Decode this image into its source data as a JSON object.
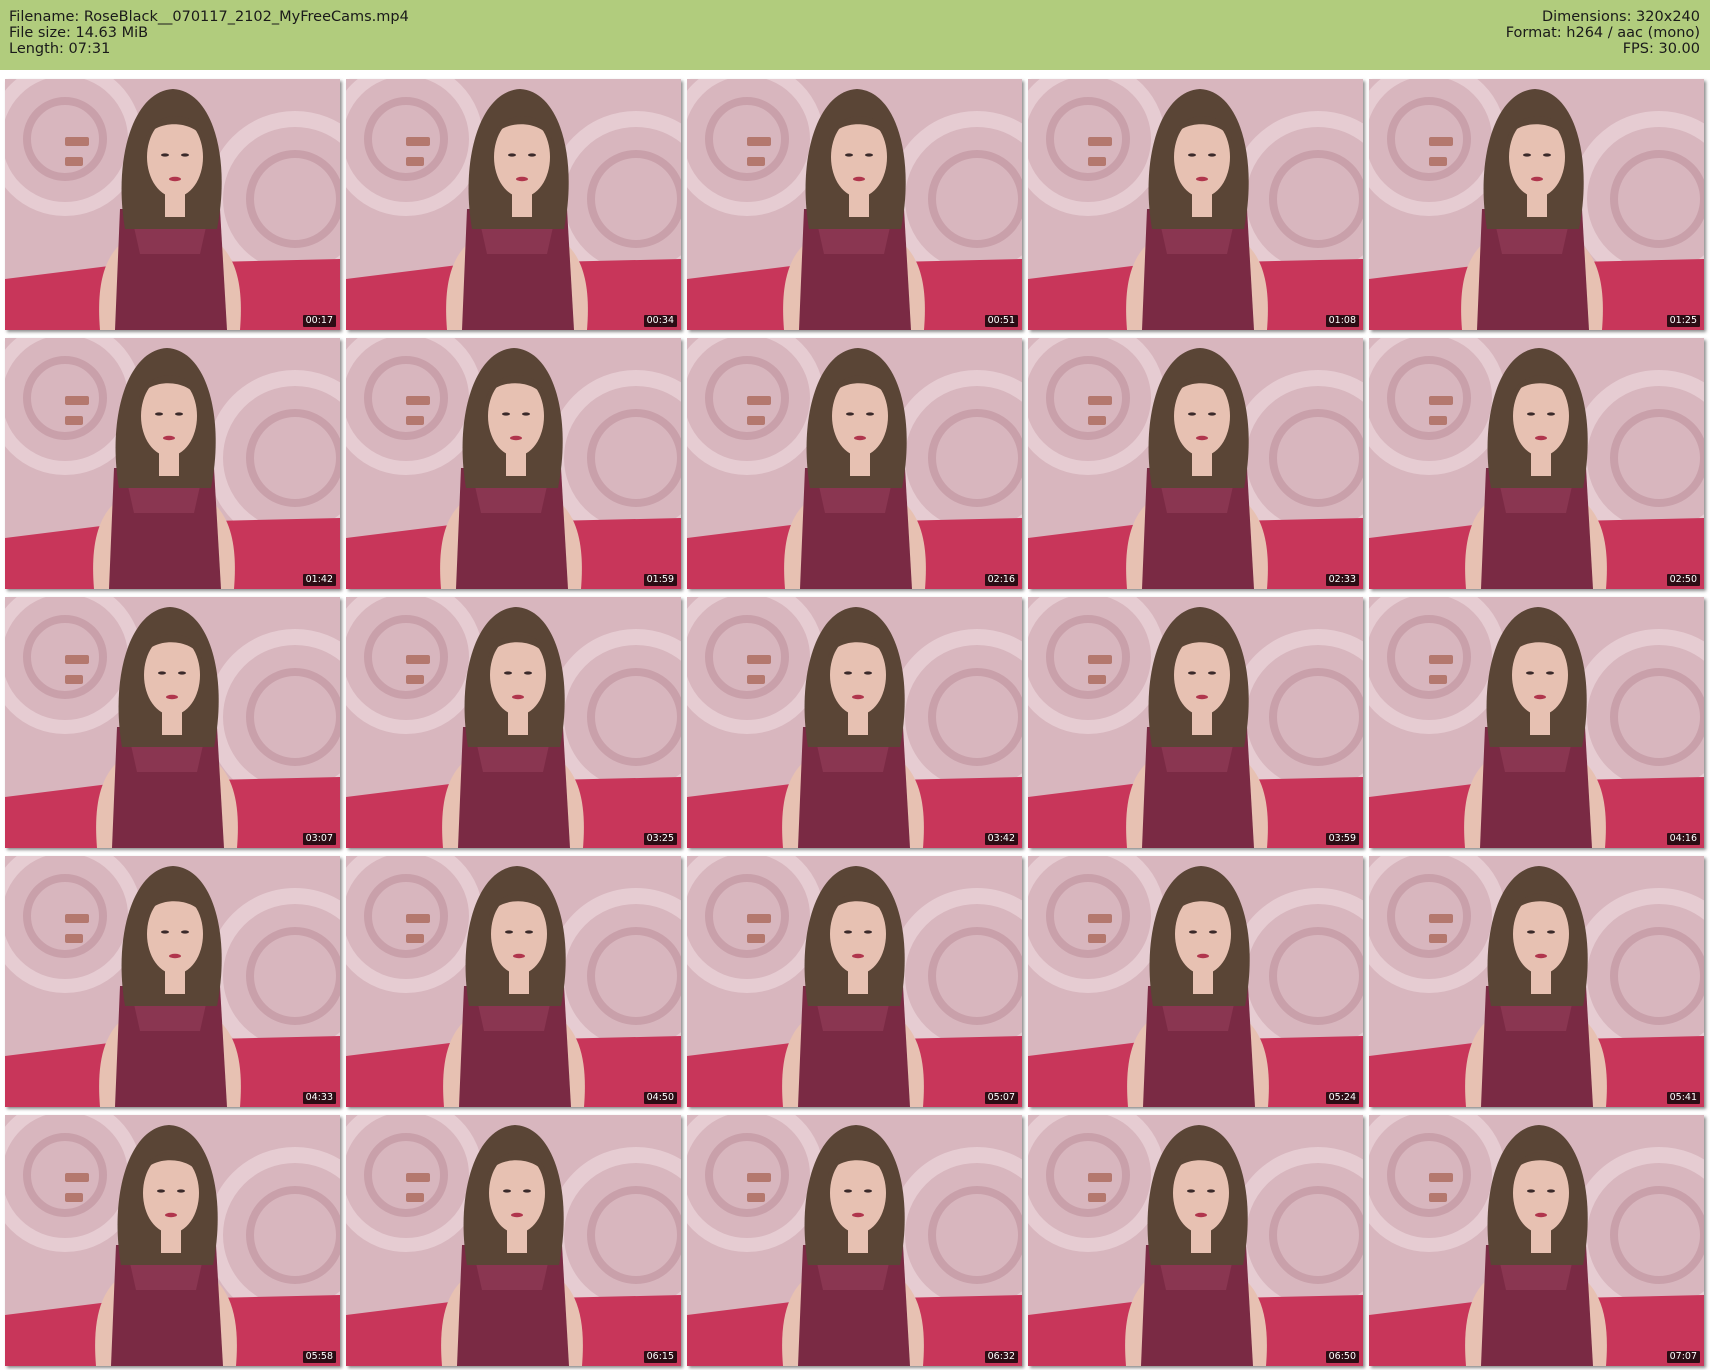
{
  "header": {
    "filename": "Filename: RoseBlack__070117_2102_MyFreeCams.mp4",
    "filesize": "File size: 14.63 MiB",
    "length": "Length: 07:31",
    "dimensions": "Dimensions: 320x240",
    "format": "Format: h264 / aac (mono)",
    "fps": "FPS: 30.00"
  },
  "colors": {
    "header_bg": "#b1cc7d",
    "wall": "#d8b6be",
    "bed": "#c8365a",
    "top": "#7a2a44",
    "hair": "#5a4536",
    "skin": "#e7c1b2"
  },
  "thumbnails": [
    {
      "time": "00:17"
    },
    {
      "time": "00:34"
    },
    {
      "time": "00:51"
    },
    {
      "time": "01:08"
    },
    {
      "time": "01:25"
    },
    {
      "time": "01:42"
    },
    {
      "time": "01:59"
    },
    {
      "time": "02:16"
    },
    {
      "time": "02:33"
    },
    {
      "time": "02:50"
    },
    {
      "time": "03:07"
    },
    {
      "time": "03:25"
    },
    {
      "time": "03:42"
    },
    {
      "time": "03:59"
    },
    {
      "time": "04:16"
    },
    {
      "time": "04:33"
    },
    {
      "time": "04:50"
    },
    {
      "time": "05:07"
    },
    {
      "time": "05:24"
    },
    {
      "time": "05:41"
    },
    {
      "time": "05:58"
    },
    {
      "time": "06:15"
    },
    {
      "time": "06:32"
    },
    {
      "time": "06:50"
    },
    {
      "time": "07:07"
    }
  ]
}
